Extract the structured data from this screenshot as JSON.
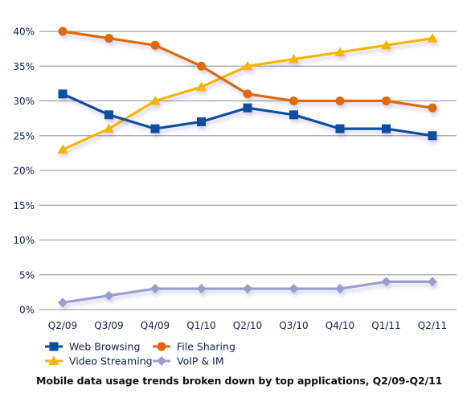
{
  "chart_data": {
    "type": "line",
    "title": "Mobile data usage trends broken down by top applications, Q2/09-Q2/11",
    "xlabel": "",
    "ylabel": "",
    "categories": [
      "Q2/09",
      "Q3/09",
      "Q4/09",
      "Q1/10",
      "Q2/10",
      "Q3/10",
      "Q4/10",
      "Q1/11",
      "Q2/11"
    ],
    "ylim": [
      0,
      40
    ],
    "yticks": [
      0,
      5,
      10,
      15,
      20,
      25,
      30,
      35,
      40
    ],
    "ytick_labels": [
      "0%",
      "5%",
      "10%",
      "15%",
      "20%",
      "25%",
      "30%",
      "35%",
      "40%"
    ],
    "grid": true,
    "legend_position": "bottom-left",
    "series": [
      {
        "name": "Web Browsing",
        "color": "#0a4ea2",
        "marker": "square",
        "values": [
          31,
          28,
          26,
          27,
          29,
          28,
          26,
          26,
          25
        ]
      },
      {
        "name": "File Sharing",
        "color": "#e0690f",
        "marker": "circle",
        "values": [
          40,
          39,
          38,
          35,
          31,
          30,
          30,
          30,
          29
        ]
      },
      {
        "name": "Video Streaming",
        "color": "#f7b500",
        "marker": "triangle",
        "values": [
          23,
          26,
          30,
          32,
          35,
          36,
          37,
          38,
          39
        ]
      },
      {
        "name": "VoIP & IM",
        "color": "#9c9cd0",
        "marker": "diamond",
        "values": [
          1,
          2,
          3,
          3,
          3,
          3,
          3,
          4,
          4
        ]
      }
    ]
  }
}
